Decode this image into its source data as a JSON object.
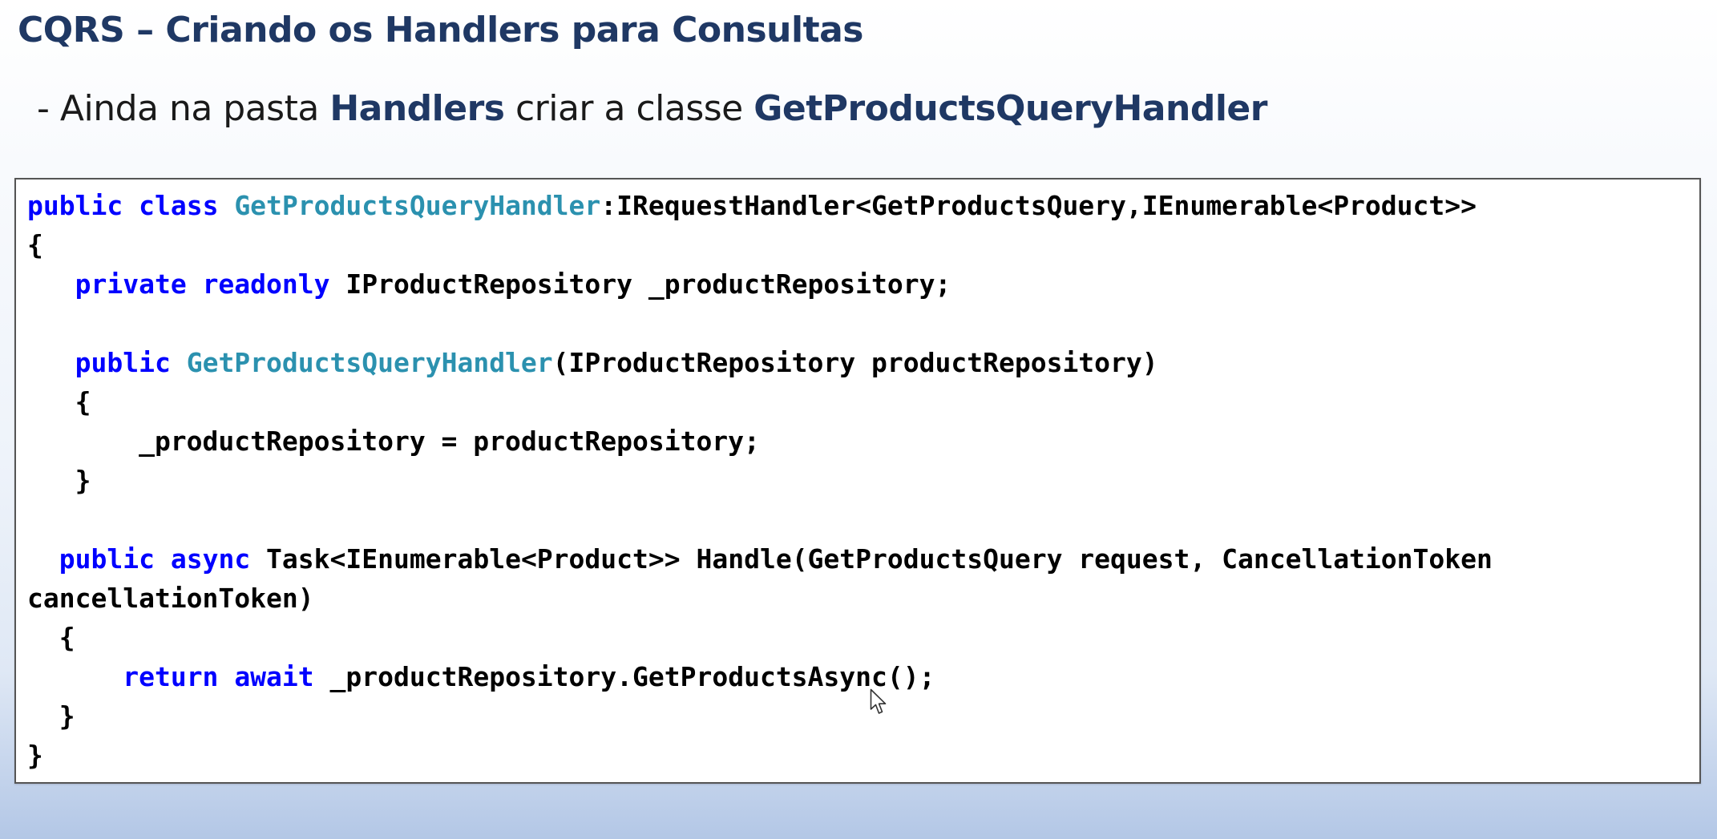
{
  "slide": {
    "title": "CQRS – Criando os Handlers para Consultas",
    "subtitle": {
      "prefix": "- Ainda na pasta ",
      "folder": "Handlers",
      "middle": " criar a classe ",
      "class_name": "GetProductsQueryHandler"
    }
  },
  "code": {
    "l1": {
      "k1": "public",
      "s1": " ",
      "k2": "class",
      "s2": " ",
      "c1": "GetProductsQueryHandler",
      "t1": ":IRequestHandler<GetProductsQuery,IEnumerable<Product>>"
    },
    "l2": {
      "t1": "{"
    },
    "l3": {
      "s0": "   ",
      "k1": "private",
      "s1": " ",
      "k2": "readonly",
      "t1": " IProductRepository _productRepository;"
    },
    "l4": {
      "t1": ""
    },
    "l5": {
      "s0": "   ",
      "k1": "public",
      "s1": " ",
      "c1": "GetProductsQueryHandler",
      "t1": "(IProductRepository productRepository)"
    },
    "l6": {
      "t1": "   {"
    },
    "l7": {
      "t1": "       _productRepository = productRepository;"
    },
    "l8": {
      "t1": "   }"
    },
    "l9": {
      "t1": ""
    },
    "l10": {
      "s0": "  ",
      "k1": "public",
      "s1": " ",
      "k2": "async",
      "t1": " Task<IEnumerable<Product>> Handle(GetProductsQuery request, CancellationToken"
    },
    "l11": {
      "t1": "cancellationToken)"
    },
    "l12": {
      "t1": "  {"
    },
    "l13": {
      "s0": "      ",
      "k1": "return",
      "s1": " ",
      "k2": "await",
      "t1": " _productRepository.GetProductsAsync();"
    },
    "l14": {
      "t1": "  }"
    },
    "l15": {
      "t1": "}"
    }
  },
  "colors": {
    "title": "#1f3864",
    "keyword": "#0000ff",
    "type_name": "#2b91af",
    "code_text": "#000000"
  },
  "icons": {
    "cursor": "mouse-pointer-icon"
  }
}
